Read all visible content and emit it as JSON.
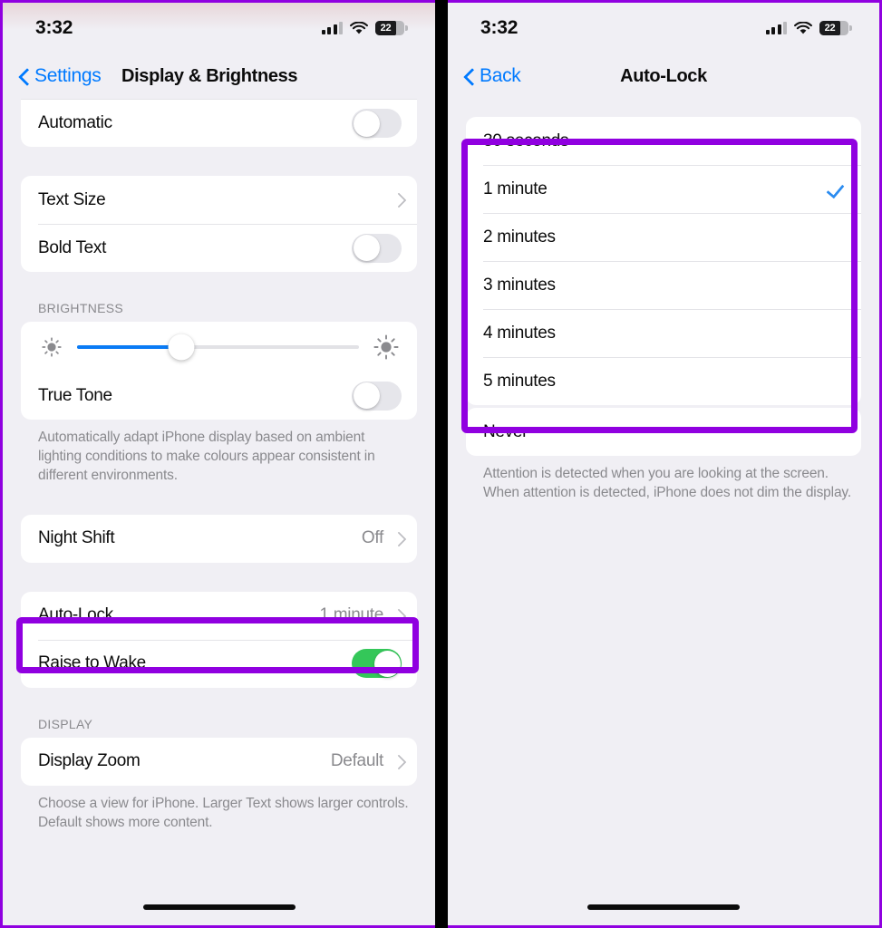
{
  "theme": {
    "accent_blue": "#007AFF",
    "highlight_purple": "#9000E0",
    "toggle_on_green": "#34C759",
    "page_background": "#F0EFF4",
    "card_background": "#FFFFFF",
    "secondary_text": "#8A8A8E"
  },
  "left_panel": {
    "status_bar": {
      "time": "3:32",
      "battery_percent": "22",
      "cellular_icon": "cellular-signal-icon",
      "wifi_icon": "wifi-icon",
      "battery_icon": "battery-icon"
    },
    "nav": {
      "back_label": "Settings",
      "back_icon": "chevron-left-icon",
      "title": "Display & Brightness"
    },
    "groups": [
      {
        "rows": [
          {
            "label": "Automatic",
            "control": "toggle",
            "toggle_on": false
          }
        ]
      },
      {
        "rows": [
          {
            "label": "Text Size",
            "control": "chevron",
            "value": ""
          },
          {
            "label": "Bold Text",
            "control": "toggle",
            "toggle_on": false
          }
        ]
      },
      {
        "header": "BRIGHTNESS",
        "slider": {
          "value_percent": 37,
          "low_icon": "sun-small-icon",
          "high_icon": "sun-large-icon"
        },
        "rows": [
          {
            "label": "True Tone",
            "control": "toggle",
            "toggle_on": false
          }
        ],
        "footer": "Automatically adapt iPhone display based on ambient lighting conditions to make colours appear consistent in different environments."
      },
      {
        "rows": [
          {
            "label": "Night Shift",
            "control": "chevron",
            "value": "Off"
          }
        ]
      },
      {
        "rows": [
          {
            "label": "Auto-Lock",
            "control": "chevron",
            "value": "1 minute",
            "highlighted": true
          },
          {
            "label": "Raise to Wake",
            "control": "toggle",
            "toggle_on": true
          }
        ]
      },
      {
        "header": "DISPLAY",
        "rows": [
          {
            "label": "Display Zoom",
            "control": "chevron",
            "value": "Default"
          }
        ],
        "footer": "Choose a view for iPhone. Larger Text shows larger controls. Default shows more content."
      }
    ],
    "home_indicator": "home-indicator"
  },
  "right_panel": {
    "status_bar": {
      "time": "3:32",
      "battery_percent": "22",
      "cellular_icon": "cellular-signal-icon",
      "wifi_icon": "wifi-icon",
      "battery_icon": "battery-icon"
    },
    "nav": {
      "back_label": "Back",
      "back_icon": "chevron-left-icon",
      "title": "Auto-Lock"
    },
    "options_group": {
      "options": [
        {
          "label": "30 seconds",
          "selected": false
        },
        {
          "label": "1 minute",
          "selected": true
        },
        {
          "label": "2 minutes",
          "selected": false
        },
        {
          "label": "3 minutes",
          "selected": false
        },
        {
          "label": "4 minutes",
          "selected": false
        },
        {
          "label": "5 minutes",
          "selected": false
        }
      ],
      "checkmark_icon": "checkmark-icon",
      "highlighted": true
    },
    "never_group": {
      "options": [
        {
          "label": "Never",
          "selected": false
        }
      ]
    },
    "footer": "Attention is detected when you are looking at the screen. When attention is detected, iPhone does not dim the display.",
    "home_indicator": "home-indicator"
  }
}
